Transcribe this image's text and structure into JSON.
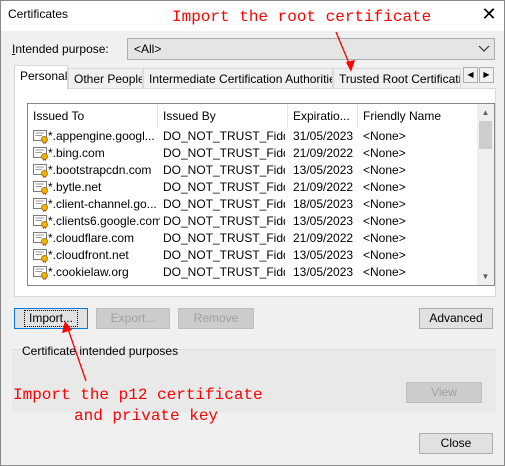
{
  "window": {
    "title": "Certificates",
    "close_glyph": "✕"
  },
  "purpose": {
    "label_prefix": "I",
    "label_rest": "ntended purpose:",
    "value": "<All>"
  },
  "tabs": [
    {
      "label": "Personal"
    },
    {
      "label": "Other People"
    },
    {
      "label": "Intermediate Certification Authorities"
    },
    {
      "label": "Trusted Root Certification Authorities"
    }
  ],
  "list": {
    "columns": [
      "Issued To",
      "Issued By",
      "Expiratio...",
      "Friendly Name"
    ],
    "rows": [
      [
        "*.appengine.googl...",
        "DO_NOT_TRUST_Fidd...",
        "31/05/2023",
        "<None>"
      ],
      [
        "*.bing.com",
        "DO_NOT_TRUST_Fidd...",
        "21/09/2022",
        "<None>"
      ],
      [
        "*.bootstrapcdn.com",
        "DO_NOT_TRUST_Fidd...",
        "13/05/2023",
        "<None>"
      ],
      [
        "*.bytle.net",
        "DO_NOT_TRUST_Fidd...",
        "21/09/2022",
        "<None>"
      ],
      [
        "*.client-channel.go...",
        "DO_NOT_TRUST_Fidd...",
        "18/05/2023",
        "<None>"
      ],
      [
        "*.clients6.google.com",
        "DO_NOT_TRUST_Fidd...",
        "13/05/2023",
        "<None>"
      ],
      [
        "*.cloudflare.com",
        "DO_NOT_TRUST_Fidd...",
        "21/09/2022",
        "<None>"
      ],
      [
        "*.cloudfront.net",
        "DO_NOT_TRUST_Fidd...",
        "13/05/2023",
        "<None>"
      ],
      [
        "*.cookielaw.org",
        "DO_NOT_TRUST_Fidd...",
        "13/05/2023",
        "<None>"
      ]
    ]
  },
  "buttons": {
    "import": "Import...",
    "export": "Export...",
    "remove": "Remove",
    "advanced": "Advanced",
    "view": "View",
    "close": "Close"
  },
  "group": {
    "title": "Certificate intended purposes"
  },
  "annotations": {
    "top": "Import the root certificate",
    "bottom_line1": "Import the p12 certificate",
    "bottom_line2": "and private key",
    "color": "#ff0000"
  }
}
